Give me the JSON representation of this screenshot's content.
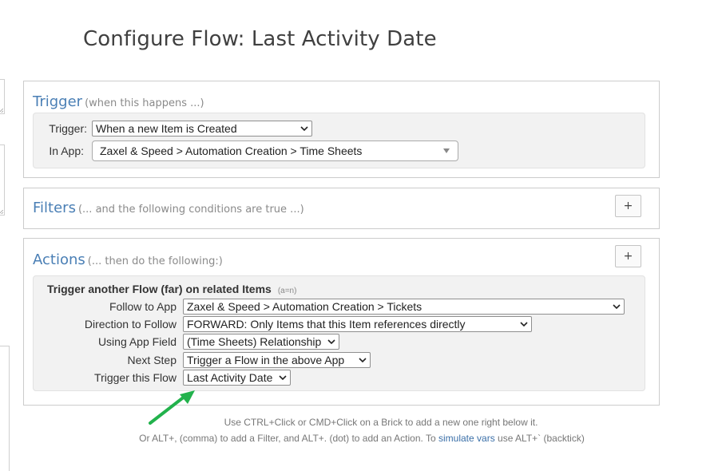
{
  "page": {
    "title": "Configure Flow: Last Activity Date"
  },
  "trigger": {
    "title": "Trigger",
    "hint": "(when this happens ...)",
    "trigger_label": "Trigger:",
    "trigger_value": "When a new Item is Created",
    "app_label": "In App:",
    "app_value": "Zaxel & Speed > Automation Creation > Time Sheets"
  },
  "filters": {
    "title": "Filters",
    "hint": "(... and the following conditions are true ...)",
    "add_label": "+"
  },
  "actions": {
    "title": "Actions",
    "hint": "(... then do the following:)",
    "add_label": "+",
    "action": {
      "title": "Trigger another Flow (far) on related Items",
      "ratio": "(a=n)",
      "rows": [
        {
          "label": "Follow to App",
          "value": "Zaxel & Speed > Automation Creation > Tickets"
        },
        {
          "label": "Direction to Follow",
          "value": "FORWARD: Only Items that this Item references directly"
        },
        {
          "label": "Using App Field",
          "value": "(Time Sheets) Relationship"
        },
        {
          "label": "Next Step",
          "value": "Trigger a Flow in the above App"
        },
        {
          "label": "Trigger this Flow",
          "value": "Last Activity Date"
        }
      ]
    }
  },
  "help": {
    "line1": "Use CTRL+Click or CMD+Click on a Brick to add a new one right below it.",
    "line2_prefix": "Or ALT+, (comma) to add a Filter, and ALT+. (dot) to add an Action. To",
    "line2_link": "simulate vars",
    "line2_suffix": "use ALT+` (backtick)"
  },
  "colors": {
    "accent": "#4a7fb5",
    "arrow": "#22b24c",
    "link": "#3a6fa8"
  },
  "icons": {
    "dropdown": "chevron-down-icon",
    "annotation": "green-arrow-icon"
  }
}
